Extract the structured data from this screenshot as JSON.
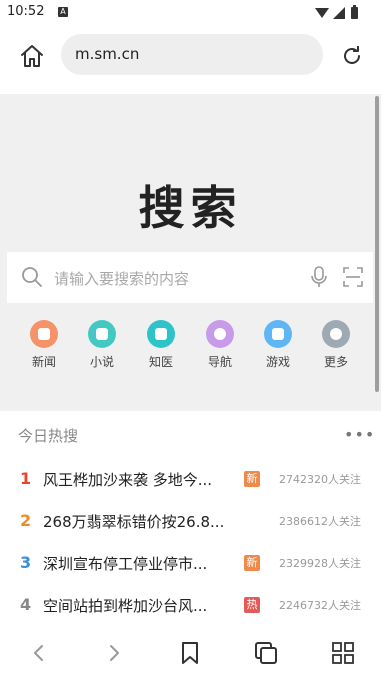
{
  "status": {
    "time": "10:52",
    "notification_icon": "A"
  },
  "toolbar": {
    "url": "m.sm.cn"
  },
  "page": {
    "logo": "搜索",
    "search_placeholder": "请输入要搜索的内容",
    "quick_links": [
      {
        "label": "新闻",
        "icon": "news-icon",
        "color": "#f5926a"
      },
      {
        "label": "小说",
        "icon": "novel-icon",
        "color": "#43c9c2"
      },
      {
        "label": "知医",
        "icon": "medical-icon",
        "color": "#2ec3c9"
      },
      {
        "label": "导航",
        "icon": "navigation-icon",
        "color": "#c79be8"
      },
      {
        "label": "游戏",
        "icon": "game-icon",
        "color": "#5fb6f5"
      },
      {
        "label": "更多",
        "icon": "more-icon",
        "color": "#9eaab3"
      }
    ]
  },
  "hot": {
    "title": "今日热搜",
    "items": [
      {
        "rank": "1",
        "rank_color": "#e8452c",
        "title": "风王桦加沙来袭 多地今...",
        "badge": "新",
        "badge_color": "#f08a4b",
        "count": "2742320人关注"
      },
      {
        "rank": "2",
        "rank_color": "#f08a24",
        "title": "268万翡翠标错价按26.8...",
        "badge": "",
        "badge_color": "",
        "count": "2386612人关注"
      },
      {
        "rank": "3",
        "rank_color": "#3a8fd9",
        "title": "深圳宣布停工停业停市...",
        "badge": "新",
        "badge_color": "#f08a4b",
        "count": "2329928人关注"
      },
      {
        "rank": "4",
        "rank_color": "#888888",
        "title": "空间站拍到桦加沙台风...",
        "badge": "热",
        "badge_color": "#e35a5a",
        "count": "2246732人关注"
      }
    ]
  }
}
